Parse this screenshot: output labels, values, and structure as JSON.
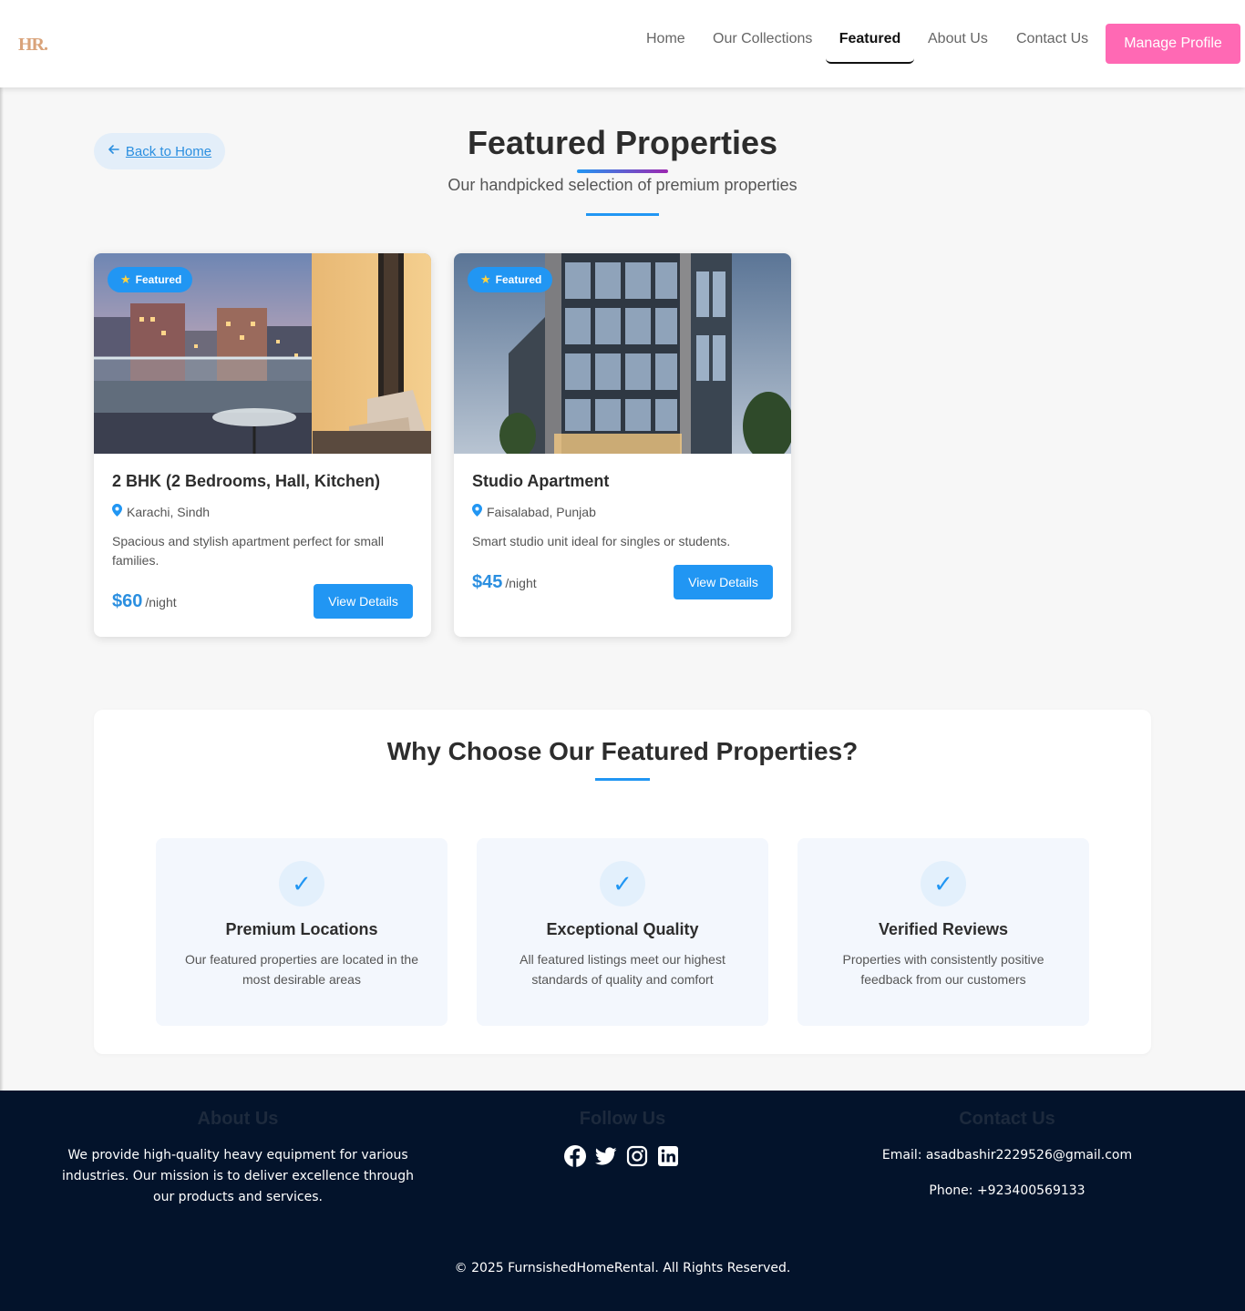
{
  "header": {
    "logo": "HR.",
    "nav": [
      "Home",
      "Our Collections",
      "Featured",
      "About Us",
      "Contact Us"
    ],
    "active_nav": "Featured",
    "manage_profile": "Manage Profile"
  },
  "page": {
    "back_label": "Back to Home",
    "title": "Featured Properties",
    "subtitle": "Our handpicked selection of premium properties"
  },
  "properties": [
    {
      "badge": "Featured",
      "title": "2 BHK (2 Bedrooms, Hall, Kitchen)",
      "location": "Karachi, Sindh",
      "description": "Spacious and stylish apartment perfect for small families.",
      "price": "$60",
      "per": "/night",
      "button": "View Details"
    },
    {
      "badge": "Featured",
      "title": "Studio Apartment",
      "location": "Faisalabad, Punjab",
      "description": "Smart studio unit ideal for singles or students.",
      "price": "$45",
      "per": "/night",
      "button": "View Details"
    }
  ],
  "why": {
    "title": "Why Choose Our Featured Properties?",
    "features": [
      {
        "title": "Premium Locations",
        "description": "Our featured properties are located in the most desirable areas"
      },
      {
        "title": "Exceptional Quality",
        "description": "All featured listings meet our highest standards of quality and comfort"
      },
      {
        "title": "Verified Reviews",
        "description": "Properties with consistently positive feedback from our customers"
      }
    ]
  },
  "footer": {
    "about_heading": "About Us",
    "about_text": "We provide high-quality heavy equipment for various industries. Our mission is to deliver excellence through our products and services.",
    "follow_heading": "Follow Us",
    "socials": [
      "facebook-icon",
      "twitter-icon",
      "instagram-icon",
      "linkedin-icon"
    ],
    "contact_heading": "Contact Us",
    "email": "Email: asadbashir2229526@gmail.com",
    "phone": "Phone: +923400569133",
    "copyright": "© 2025 FurnsishedHomeRental. All Rights Reserved."
  },
  "colors": {
    "accent": "#2196f3",
    "manage_button": "#ff69b4",
    "footer_bg": "#03132b"
  }
}
